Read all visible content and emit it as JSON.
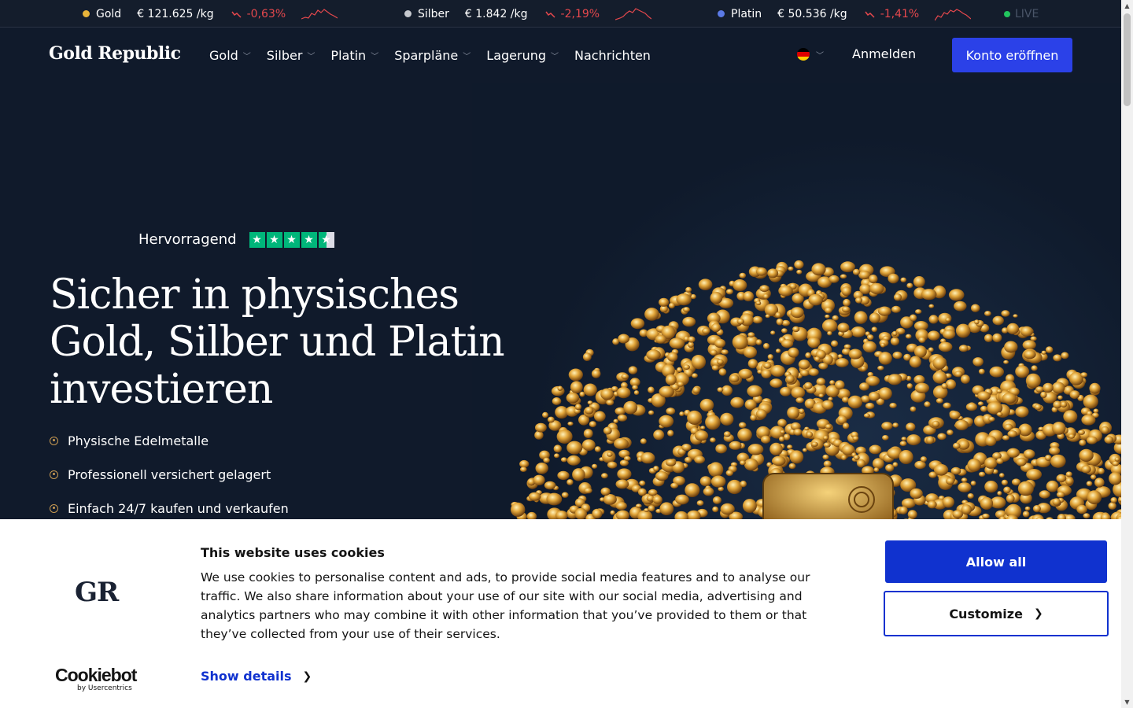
{
  "ticker": {
    "items": [
      {
        "name": "Gold",
        "price": "€ 121.625 /kg",
        "change": "-0,63%",
        "dot_color": "#e8b43a"
      },
      {
        "name": "Silber",
        "price": "€ 1.842 /kg",
        "change": "-2,19%",
        "dot_color": "#c5c8ce"
      },
      {
        "name": "Platin",
        "price": "€ 50.536 /kg",
        "change": "-1,41%",
        "dot_color": "#5b7ae6"
      }
    ],
    "live_label": "LIVE"
  },
  "header": {
    "logo": "Gold Republic",
    "nav": [
      {
        "label": "Gold",
        "has_dropdown": true
      },
      {
        "label": "Silber",
        "has_dropdown": true
      },
      {
        "label": "Platin",
        "has_dropdown": true
      },
      {
        "label": "Sparpläne",
        "has_dropdown": true
      },
      {
        "label": "Lagerung",
        "has_dropdown": true
      },
      {
        "label": "Nachrichten",
        "has_dropdown": false
      }
    ],
    "login": "Anmelden",
    "cta": "Konto eröffnen"
  },
  "hero": {
    "rating_label": "Hervorragend",
    "rating_stars": 4.5,
    "headline": "Sicher in physisches Gold, Silber und Platin investieren",
    "bullets": [
      "Physische Edelmetalle",
      "Professionell versichert gelagert",
      "Einfach 24/7 kaufen und verkaufen"
    ]
  },
  "cookie": {
    "brand_logo": "GR",
    "provider": "Cookiebot",
    "provider_sub": "by Usercentrics",
    "title": "This website uses cookies",
    "text": "We use cookies to personalise content and ads, to provide social media features and to analyse our traffic. We also share information about your use of our site with our social media, advertising and analytics partners who may combine it with other information that you’ve provided to them or that they’ve collected from your use of their services.",
    "show_details": "Show details",
    "allow_all": "Allow all",
    "customize": "Customize"
  },
  "colors": {
    "accent": "#2b41e8",
    "cookie_accent": "#1032cf",
    "negative": "#e5484d",
    "trustpilot": "#00b67a"
  }
}
